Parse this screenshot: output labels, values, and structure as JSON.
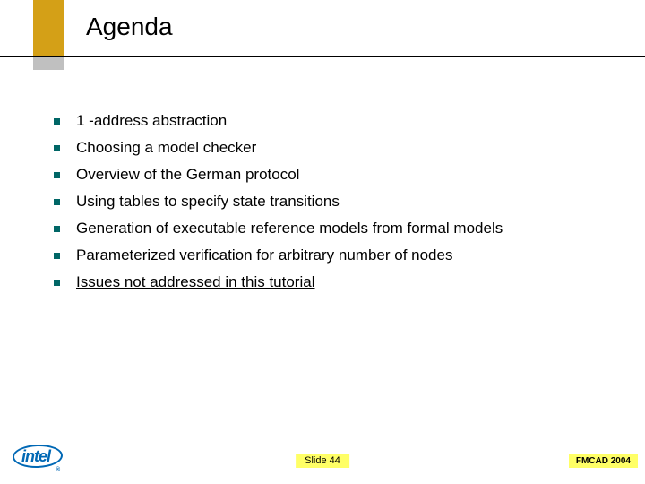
{
  "title": "Agenda",
  "bullets": [
    {
      "text": "1 -address abstraction",
      "underlined": false
    },
    {
      "text": "Choosing a model checker",
      "underlined": false
    },
    {
      "text": "Overview of the German protocol",
      "underlined": false
    },
    {
      "text": "Using tables to specify state transitions",
      "underlined": false
    },
    {
      "text": "Generation of executable reference models from formal models",
      "underlined": false
    },
    {
      "text": "Parameterized verification for arbitrary number of nodes",
      "underlined": false
    },
    {
      "text": "Issues not addressed in this tutorial",
      "underlined": true
    }
  ],
  "footer": {
    "logo_text": "intel",
    "logo_trademark": "®",
    "slide_label": "Slide 44",
    "conference": "FMCAD 2004"
  }
}
